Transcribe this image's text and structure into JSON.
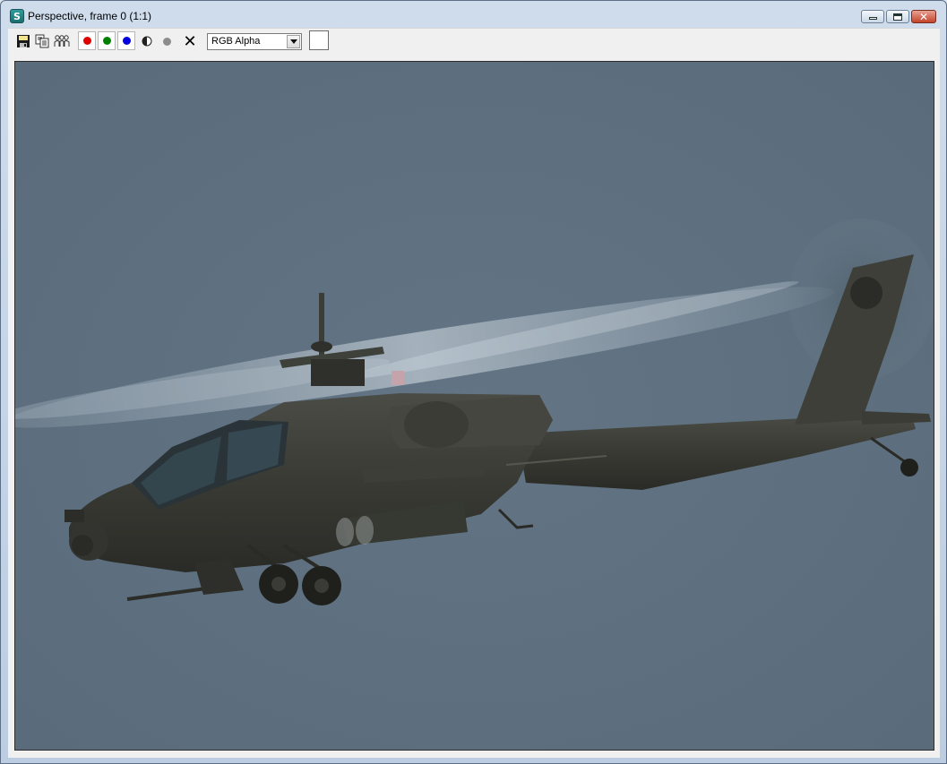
{
  "window": {
    "title": "Perspective, frame 0 (1:1)",
    "app_icon_glyph": "S"
  },
  "titlebar_buttons": {
    "minimize": "minimize-icon",
    "maximize": "restore-icon",
    "close_glyph": "✕"
  },
  "toolbar": {
    "icons": [
      "save-icon",
      "copy-icon",
      "clone-icon"
    ],
    "channels": [
      {
        "name": "red",
        "color": "#e00000"
      },
      {
        "name": "green",
        "color": "#008000"
      },
      {
        "name": "blue",
        "color": "#0000e0"
      }
    ],
    "monochrome_icon": "monochrome-icon",
    "alpha_icon": "alpha-icon",
    "clear_glyph": "✕",
    "channel_select": "RGB Alpha",
    "color_swatch": "#ffffff"
  },
  "viewport": {
    "background": "#5f7181",
    "content": "helicopter-render"
  }
}
